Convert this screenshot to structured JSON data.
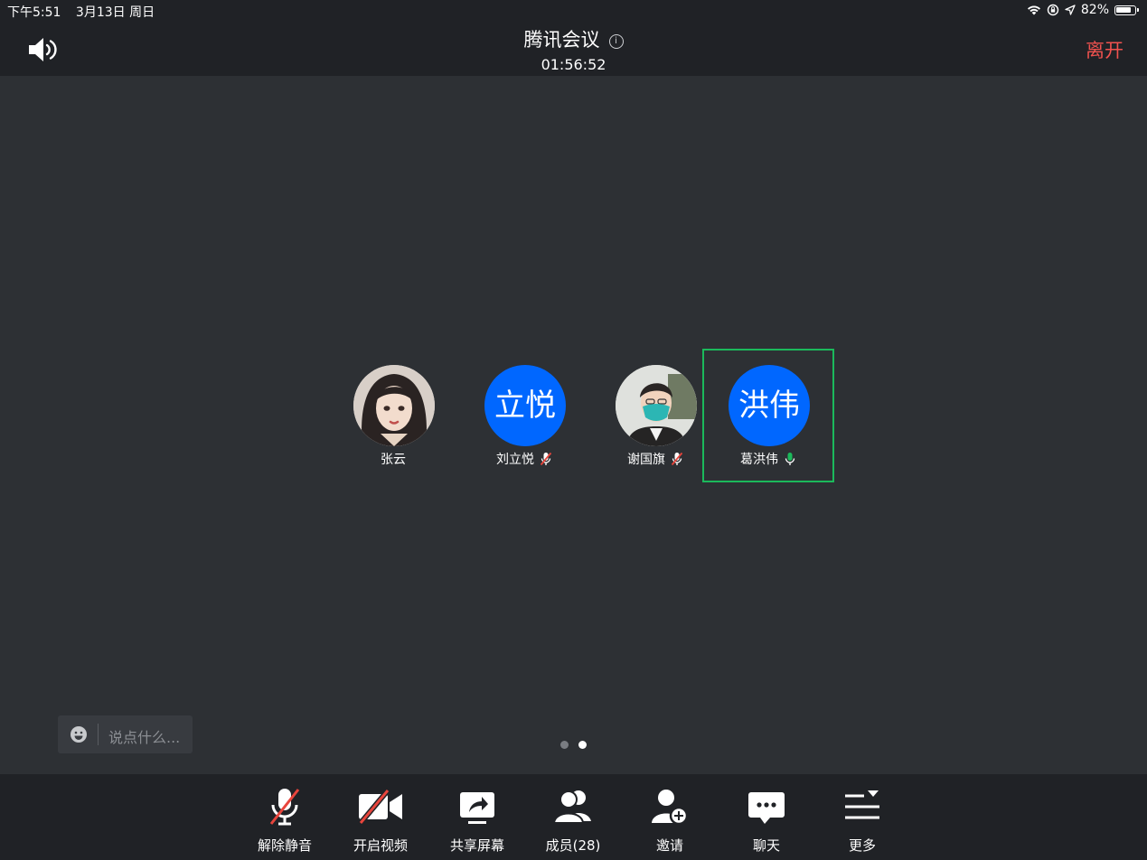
{
  "status_bar": {
    "time": "下午5:51",
    "date": "3月13日 周日",
    "battery": "82%",
    "battery_level": 0.82
  },
  "header": {
    "title": "腾讯会议",
    "duration": "01:56:52",
    "leave_label": "离开",
    "leave_color": "#f0524f"
  },
  "participants": [
    {
      "name": "张云",
      "avatar_type": "photo",
      "avatar_text": "",
      "mic": "none"
    },
    {
      "name": "刘立悦",
      "avatar_type": "initials",
      "avatar_text": "立悦",
      "mic": "muted"
    },
    {
      "name": "谢国旗",
      "avatar_type": "photo",
      "avatar_text": "",
      "mic": "muted"
    },
    {
      "name": "葛洪伟",
      "avatar_type": "initials",
      "avatar_text": "洪伟",
      "mic": "speaking",
      "active": true
    }
  ],
  "chat": {
    "placeholder": "说点什么..."
  },
  "pagination": {
    "pages": 2,
    "current": 2
  },
  "toolbar": {
    "items": [
      {
        "label": "解除静音",
        "icon": "mic-muted-icon"
      },
      {
        "label": "开启视频",
        "icon": "camera-off-icon"
      },
      {
        "label": "共享屏幕",
        "icon": "share-screen-icon"
      },
      {
        "label": "成员(28)",
        "icon": "members-icon"
      },
      {
        "label": "邀请",
        "icon": "invite-icon"
      },
      {
        "label": "聊天",
        "icon": "chat-icon"
      },
      {
        "label": "更多",
        "icon": "more-menu-icon"
      }
    ]
  },
  "colors": {
    "accent_blue": "#0067ff",
    "speaking_green": "#1bb95b",
    "mute_red": "#e8453c"
  }
}
